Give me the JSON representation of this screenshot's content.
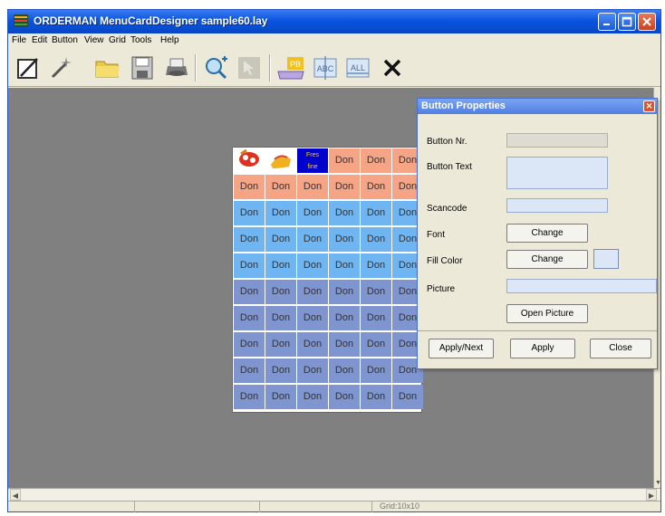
{
  "window": {
    "title": "ORDERMAN MenuCardDesigner sample60.lay"
  },
  "menu": [
    "File",
    "Edit",
    "Button",
    "View",
    "Grid",
    "Tools",
    "Help"
  ],
  "toolbar": {
    "icons": [
      "draw-rect-icon",
      "magic-wand-icon",
      "open-folder-icon",
      "save-disk-icon",
      "print-icon",
      "zoom-in-icon",
      "pointer-icon",
      "picture-button-icon",
      "abc-text-icon",
      "all-text-icon",
      "delete-x-icon"
    ],
    "picture_button_label": "PB",
    "abc_label": "ABC",
    "all_label": "ALL"
  },
  "grid": {
    "cell_text": "Don",
    "selected_cell_text": [
      "Fres",
      "fine"
    ],
    "rows": [
      [
        "img",
        "img",
        "sel",
        "salmon",
        "salmon",
        "salmon"
      ],
      [
        "salmon",
        "salmon",
        "salmon",
        "salmon",
        "salmon",
        "salmon"
      ],
      [
        "blue",
        "blue",
        "blue",
        "blue",
        "blue",
        "blue"
      ],
      [
        "blue",
        "blue",
        "blue",
        "blue",
        "blue",
        "blue"
      ],
      [
        "blue",
        "blue",
        "blue",
        "blue",
        "blue",
        "blue"
      ],
      [
        "lavender",
        "lavender",
        "lavender",
        "lavender",
        "lavender",
        "lavender"
      ],
      [
        "lavender",
        "lavender",
        "lavender",
        "lavender",
        "lavender",
        "lavender"
      ],
      [
        "lavender",
        "lavender",
        "lavender",
        "lavender",
        "lavender",
        "lavender"
      ],
      [
        "lavender",
        "lavender",
        "lavender",
        "lavender",
        "lavender",
        "lavender"
      ],
      [
        "lavender",
        "lavender",
        "lavender",
        "lavender",
        "lavender",
        "lavender"
      ]
    ]
  },
  "dialog": {
    "title": "Button Properties",
    "labels": {
      "button_nr": "Button Nr.",
      "button_text": "Button Text",
      "scancode": "Scancode",
      "font": "Font",
      "fill_color": "Fill Color",
      "picture": "Picture"
    },
    "buttons": {
      "font_change": "Change",
      "fill_change": "Change",
      "open_picture": "Open Picture",
      "apply_next": "Apply/Next",
      "apply": "Apply",
      "close": "Close"
    }
  },
  "status": {
    "grid_size": "Grid:10x10"
  },
  "colors": {
    "salmon": "#f5a485",
    "blue": "#6eb5f2",
    "lavender": "#7f95cf",
    "selected": "#0000cc",
    "workarea": "#808080"
  }
}
